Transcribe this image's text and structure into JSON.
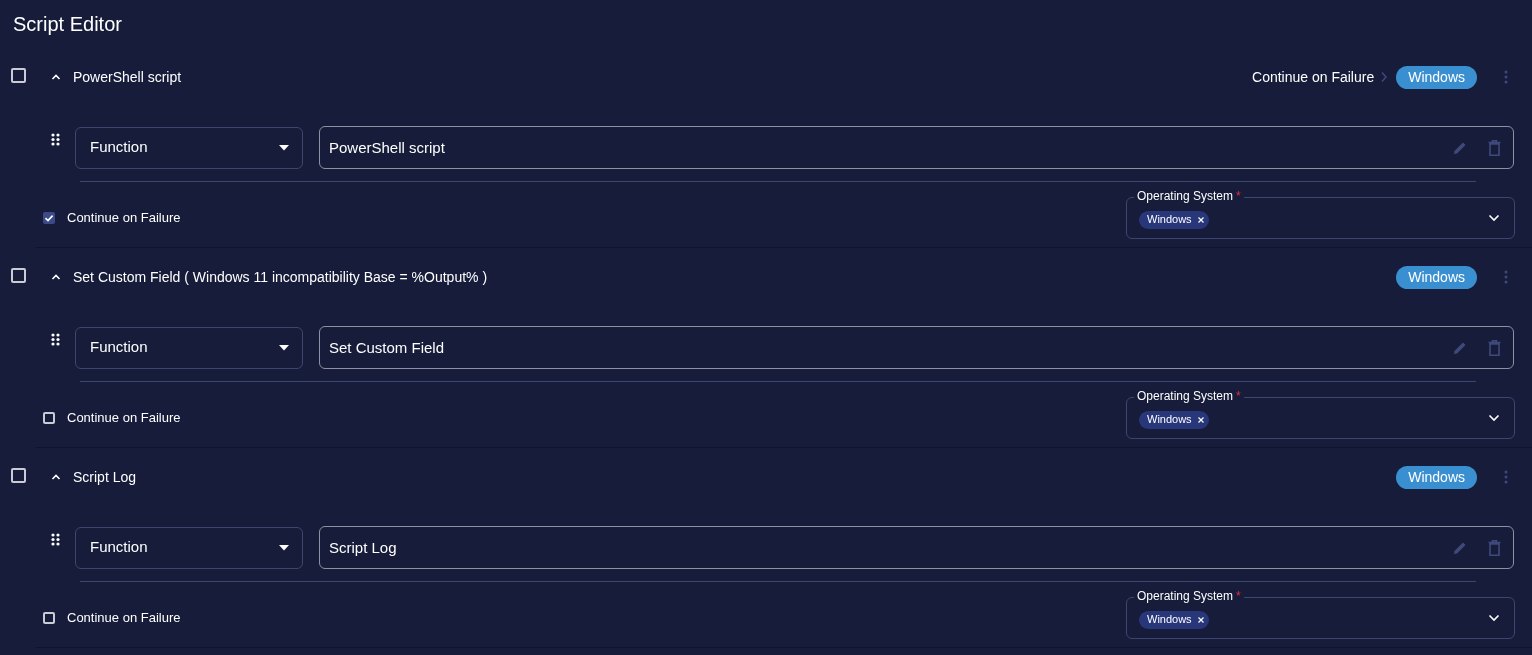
{
  "title": "Script Editor",
  "steps": [
    {
      "selected": false,
      "expanded": true,
      "title": "PowerShell script",
      "summary": "Continue on Failure",
      "os_badge": "Windows",
      "function_select": "Function",
      "name_value": "PowerShell script",
      "continue_on_failure": {
        "label": "Continue on Failure",
        "checked": true
      },
      "os_field": {
        "label": "Operating System",
        "required_mark": "*",
        "chips": [
          "Windows"
        ]
      }
    },
    {
      "selected": false,
      "expanded": true,
      "title": "Set Custom Field ( Windows 11 incompatibility Base = %Output% )",
      "os_badge": "Windows",
      "function_select": "Function",
      "name_value": "Set Custom Field",
      "continue_on_failure": {
        "label": "Continue on Failure",
        "checked": false
      },
      "os_field": {
        "label": "Operating System",
        "required_mark": "*",
        "chips": [
          "Windows"
        ]
      }
    },
    {
      "selected": false,
      "expanded": true,
      "title": "Script Log",
      "os_badge": "Windows",
      "function_select": "Function",
      "name_value": "Script Log",
      "continue_on_failure": {
        "label": "Continue on Failure",
        "checked": false
      },
      "os_field": {
        "label": "Operating System",
        "required_mark": "*",
        "chips": [
          "Windows"
        ]
      }
    }
  ]
}
